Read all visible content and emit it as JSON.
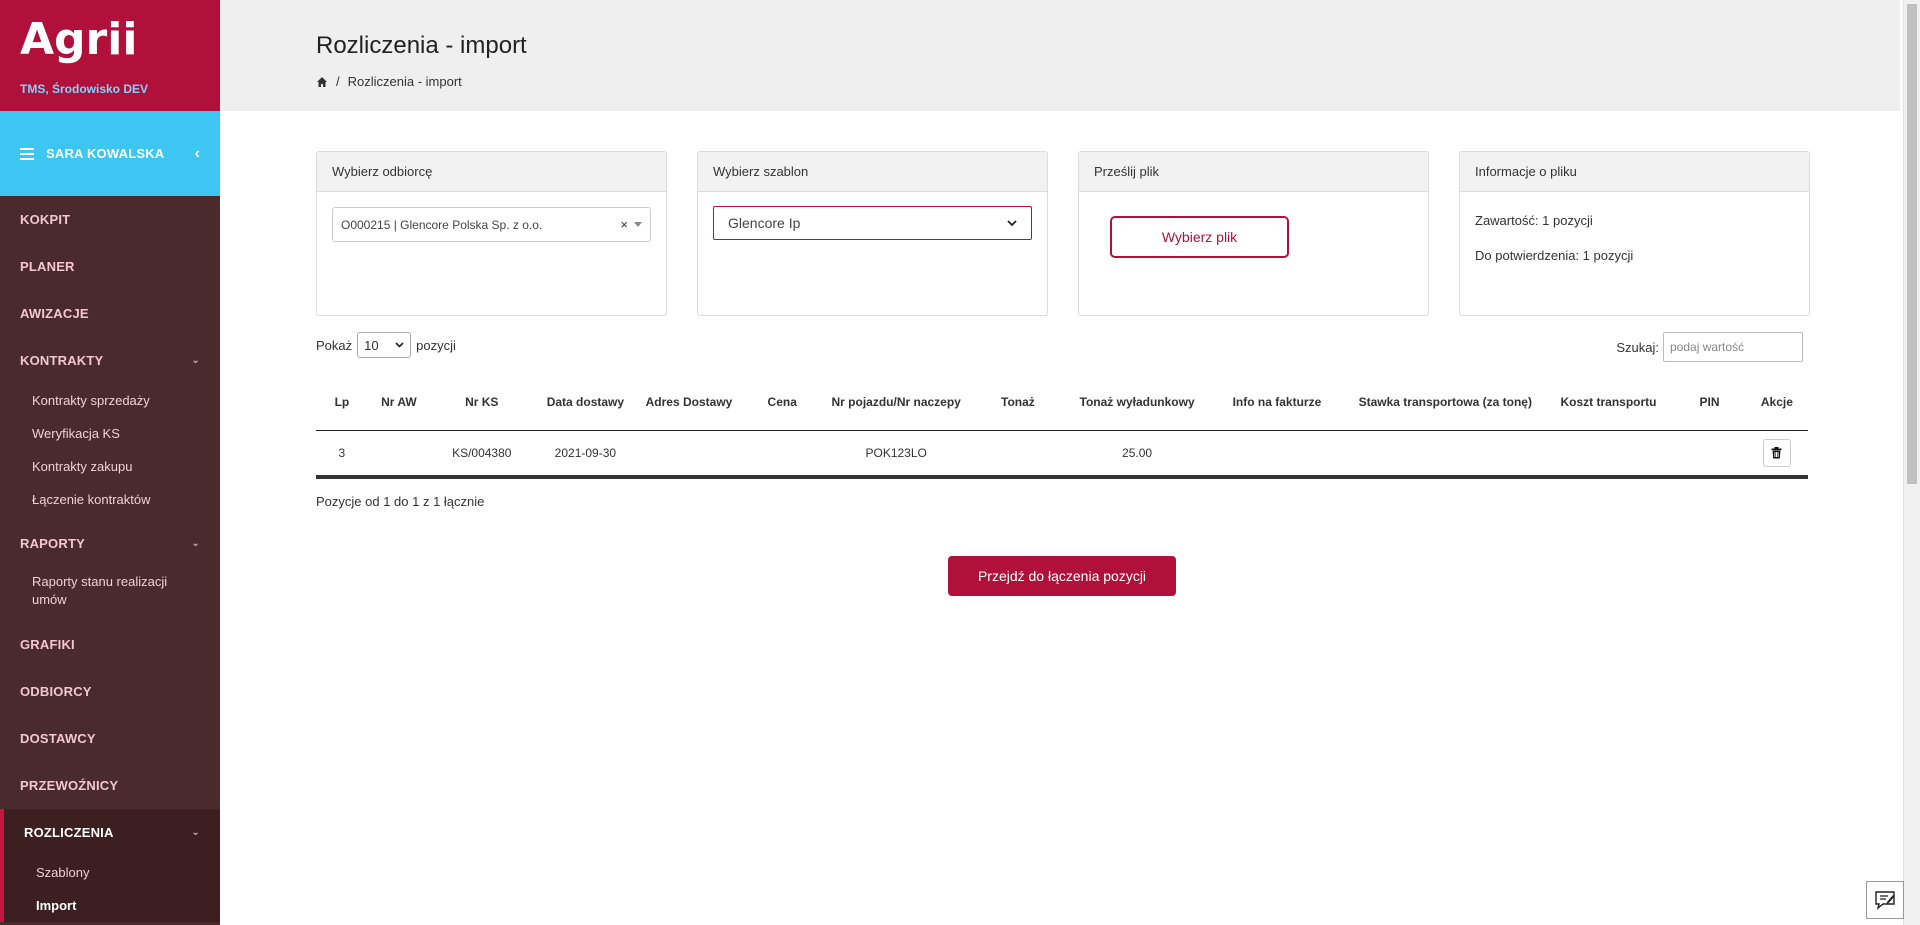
{
  "brand": {
    "logo": "Agrii",
    "subtitle": "TMS, Środowisko DEV"
  },
  "user": {
    "name": "SARA KOWALSKA"
  },
  "nav": {
    "kokpit": "KOKPIT",
    "planer": "PLANER",
    "awizacje": "AWIZACJE",
    "kontrakty": "KONTRAKTY",
    "kontrakty_items": [
      "Kontrakty sprzedaży",
      "Weryfikacja KS",
      "Kontrakty zakupu",
      "Łączenie kontraktów"
    ],
    "raporty": "RAPORTY",
    "raporty_items": [
      "Raporty stanu realizacji umów"
    ],
    "grafiki": "GRAFIKI",
    "odbiorcy": "ODBIORCY",
    "dostawcy": "DOSTAWCY",
    "przewoznicy": "PRZEWOŹNICY",
    "rozliczenia": "ROZLICZENIA",
    "rozliczenia_items": [
      "Szablony",
      "Import"
    ]
  },
  "header": {
    "title": "Rozliczenia - import",
    "breadcrumb_sep": "/",
    "breadcrumb_current": "Rozliczenia - import"
  },
  "cards": {
    "recipient": {
      "title": "Wybierz odbiorcę",
      "value": "O000215 | Glencore Polska Sp. z o.o.",
      "clear": "×"
    },
    "template": {
      "title": "Wybierz szablon",
      "value": "Glencore Ip"
    },
    "upload": {
      "title": "Prześlij plik",
      "button": "Wybierz plik"
    },
    "info": {
      "title": "Informacje o pliku",
      "content": "Zawartość: 1 pozycji",
      "pending": "Do potwierdzenia: 1 pozycji"
    }
  },
  "table_controls": {
    "show_label": "Pokaż",
    "page_size": "10",
    "items_label": "pozycji",
    "search_label": "Szukaj:",
    "search_placeholder": "podaj wartość"
  },
  "table": {
    "headers": [
      "Lp",
      "Nr AW",
      "Nr KS",
      "Data dostawy",
      "Adres Dostawy",
      "Cena",
      "Nr pojazdu/Nr naczepy",
      "Tonaż",
      "Tonaż wyładunkowy",
      "Info na fakturze",
      "Stawka transportowa (za tonę)",
      "Koszt transportu",
      "PIN",
      "Akcje"
    ],
    "rows": [
      [
        "3",
        "",
        "KS/004380",
        "2021-09-30",
        "",
        "",
        "POK123LO",
        "",
        "25.00",
        "",
        "",
        "",
        "",
        ""
      ]
    ],
    "summary": "Pozycje od 1 do 1 z 1 łącznie"
  },
  "actions": {
    "proceed": "Przejdź do łączenia pozycji"
  },
  "colors": {
    "brand": "#b0103a",
    "sidebar": "#4a2a2c",
    "user_bar": "#3ec6f2"
  }
}
